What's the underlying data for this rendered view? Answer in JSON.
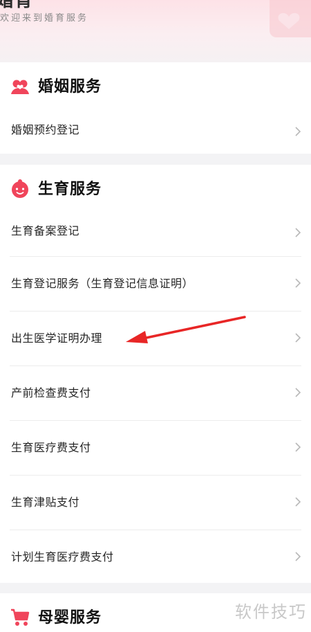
{
  "banner": {
    "title": "婚育",
    "subtitle": "欢迎来到婚育服务"
  },
  "sections": [
    {
      "title": "婚姻服务",
      "icon": "marriage-icon",
      "items": [
        "婚姻预约登记"
      ]
    },
    {
      "title": "生育服务",
      "icon": "baby-icon",
      "items": [
        "生育备案登记",
        "生育登记服务（生育登记信息证明）",
        "出生医学证明办理",
        "产前检查费支付",
        "生育医疗费支付",
        "生育津贴支付",
        "计划生育医疗费支付"
      ]
    },
    {
      "title": "母婴服务",
      "icon": "stroller-icon",
      "items": []
    }
  ],
  "watermark": "软件技巧",
  "colors": {
    "accent": "#f0455b",
    "arrow": "#e82626",
    "banner": "#fde2e7"
  }
}
